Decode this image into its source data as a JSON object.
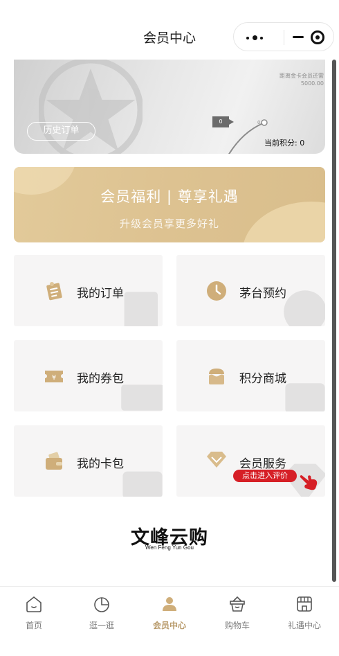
{
  "header": {
    "title": "会员中心"
  },
  "card": {
    "upgrade_text": "距离金卡会员还需5000.00",
    "history_button": "历史订单",
    "progress_label": "0",
    "progress_dot_label": "0",
    "points_text": "当前积分: 0"
  },
  "banner": {
    "title": "会员福利 | 尊享礼遇",
    "subtitle": "升级会员享更多好礼"
  },
  "grid": {
    "my_orders": "我的订单",
    "moutai_reservation": "茅台预约",
    "my_coupons": "我的券包",
    "points_mall": "积分商城",
    "my_cards": "我的卡包",
    "member_service": "会员服务",
    "evaluate_badge": "点击进入评价"
  },
  "brand": {
    "name_cn": "文峰云购",
    "name_en": "Wen Feng Yun Gou"
  },
  "tabbar": {
    "home": "首页",
    "browse": "逛一逛",
    "member_center": "会员中心",
    "cart": "购物车",
    "gift_center": "礼遇中心"
  },
  "colors": {
    "gold_accent": "#cfae7a",
    "tab_active": "#b89a6a",
    "badge_red": "#d61f26"
  },
  "icons": {
    "capsule_more": "more-dots-icon",
    "capsule_minimize": "minimize-icon",
    "capsule_close": "close-circle-icon"
  }
}
